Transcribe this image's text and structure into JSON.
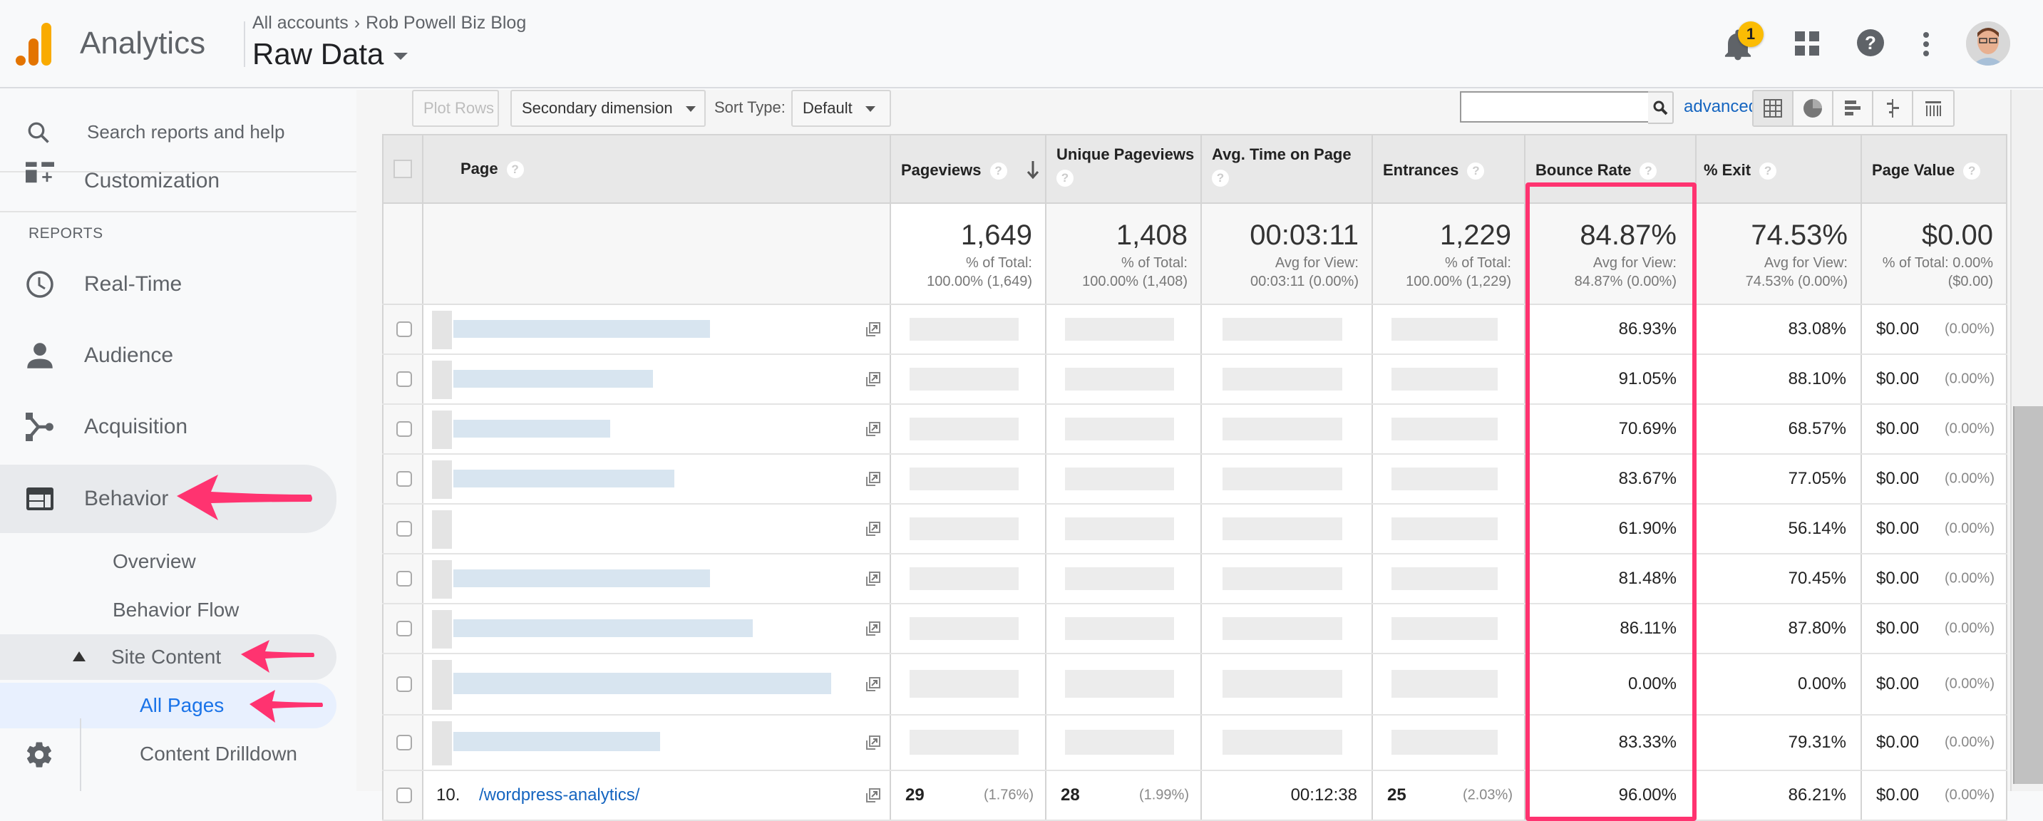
{
  "header": {
    "app_name": "Analytics",
    "breadcrumb_root": "All accounts",
    "breadcrumb_separator": "›",
    "account_name": "Rob Powell Biz Blog",
    "view_name": "Raw Data",
    "notification_count": "1",
    "icons": [
      "bell-icon",
      "apps-grid-icon",
      "help-icon",
      "more-vert-icon",
      "avatar"
    ]
  },
  "sidebar": {
    "search_placeholder": "Search reports and help",
    "customization_label": "Customization",
    "reports_header": "REPORTS",
    "items": [
      {
        "label": "Real-Time",
        "icon": "clock-icon"
      },
      {
        "label": "Audience",
        "icon": "person-icon"
      },
      {
        "label": "Acquisition",
        "icon": "acquisition-icon"
      },
      {
        "label": "Behavior",
        "icon": "behavior-icon",
        "active": true
      }
    ],
    "behavior_sub": [
      {
        "label": "Overview"
      },
      {
        "label": "Behavior Flow"
      },
      {
        "label": "Site Content",
        "expanded": true
      },
      {
        "label": "All Pages",
        "selected": true
      },
      {
        "label": "Content Drilldown"
      }
    ]
  },
  "toolbar": {
    "plot_rows": "Plot Rows",
    "secondary_dimension": "Secondary dimension",
    "sort_type_label": "Sort Type:",
    "sort_type_value": "Default",
    "search_value": "",
    "advanced": "advanced",
    "view_buttons": [
      "table-view-icon",
      "pie-view-icon",
      "performance-view-icon",
      "comparison-view-icon",
      "pivot-view-icon"
    ]
  },
  "table": {
    "columns": [
      {
        "key": "page",
        "label": "Page"
      },
      {
        "key": "pageviews",
        "label": "Pageviews",
        "sorted": "desc"
      },
      {
        "key": "unique_pageviews",
        "label": "Unique Pageviews"
      },
      {
        "key": "avg_time",
        "label": "Avg. Time on Page"
      },
      {
        "key": "entrances",
        "label": "Entrances"
      },
      {
        "key": "bounce_rate",
        "label": "Bounce Rate"
      },
      {
        "key": "exit",
        "label": "% Exit"
      },
      {
        "key": "page_value",
        "label": "Page Value"
      }
    ],
    "summary": {
      "pageviews": {
        "value": "1,649",
        "sub1": "% of Total:",
        "sub2": "100.00% (1,649)"
      },
      "unique_pageviews": {
        "value": "1,408",
        "sub1": "% of Total:",
        "sub2": "100.00% (1,408)"
      },
      "avg_time": {
        "value": "00:03:11",
        "sub1": "Avg for View:",
        "sub2": "00:03:11 (0.00%)"
      },
      "entrances": {
        "value": "1,229",
        "sub1": "% of Total:",
        "sub2": "100.00% (1,229)"
      },
      "bounce_rate": {
        "value": "84.87%",
        "sub1": "Avg for View:",
        "sub2": "84.87% (0.00%)"
      },
      "exit": {
        "value": "74.53%",
        "sub1": "Avg for View:",
        "sub2": "74.53% (0.00%)"
      },
      "page_value": {
        "value": "$0.00",
        "sub1": "% of Total: 0.00%",
        "sub2": "($0.00)"
      }
    },
    "rows": [
      {
        "bounce_rate": "86.93%",
        "exit": "83.08%",
        "page_value": "$0.00",
        "page_value_pct": "(0.00%)"
      },
      {
        "bounce_rate": "91.05%",
        "exit": "88.10%",
        "page_value": "$0.00",
        "page_value_pct": "(0.00%)"
      },
      {
        "bounce_rate": "70.69%",
        "exit": "68.57%",
        "page_value": "$0.00",
        "page_value_pct": "(0.00%)"
      },
      {
        "bounce_rate": "83.67%",
        "exit": "77.05%",
        "page_value": "$0.00",
        "page_value_pct": "(0.00%)"
      },
      {
        "bounce_rate": "61.90%",
        "exit": "56.14%",
        "page_value": "$0.00",
        "page_value_pct": "(0.00%)"
      },
      {
        "bounce_rate": "81.48%",
        "exit": "70.45%",
        "page_value": "$0.00",
        "page_value_pct": "(0.00%)"
      },
      {
        "bounce_rate": "86.11%",
        "exit": "87.80%",
        "page_value": "$0.00",
        "page_value_pct": "(0.00%)"
      },
      {
        "bounce_rate": "0.00%",
        "exit": "0.00%",
        "page_value": "$0.00",
        "page_value_pct": "(0.00%)"
      },
      {
        "bounce_rate": "83.33%",
        "exit": "79.31%",
        "page_value": "$0.00",
        "page_value_pct": "(0.00%)"
      }
    ],
    "partial_row": {
      "index": "10.",
      "page": "/wordpress-analytics/",
      "pageviews": "29",
      "pageviews_pct": "(1.76%)",
      "unique_pageviews": "28",
      "unique_pageviews_pct": "(1.99%)",
      "avg_time": "00:12:38",
      "entrances": "25",
      "entrances_pct": "(2.03%)",
      "bounce_rate": "96.00%",
      "exit": "86.21%",
      "page_value": "$0.00",
      "page_value_pct": "(0.00%)"
    }
  },
  "colors": {
    "highlight": "#ff3370",
    "link": "#1565c0",
    "selected_nav": "#1a73e8",
    "badge": "#fbbc04",
    "logo_dark": "#e37400",
    "logo_light": "#f9ab00"
  }
}
